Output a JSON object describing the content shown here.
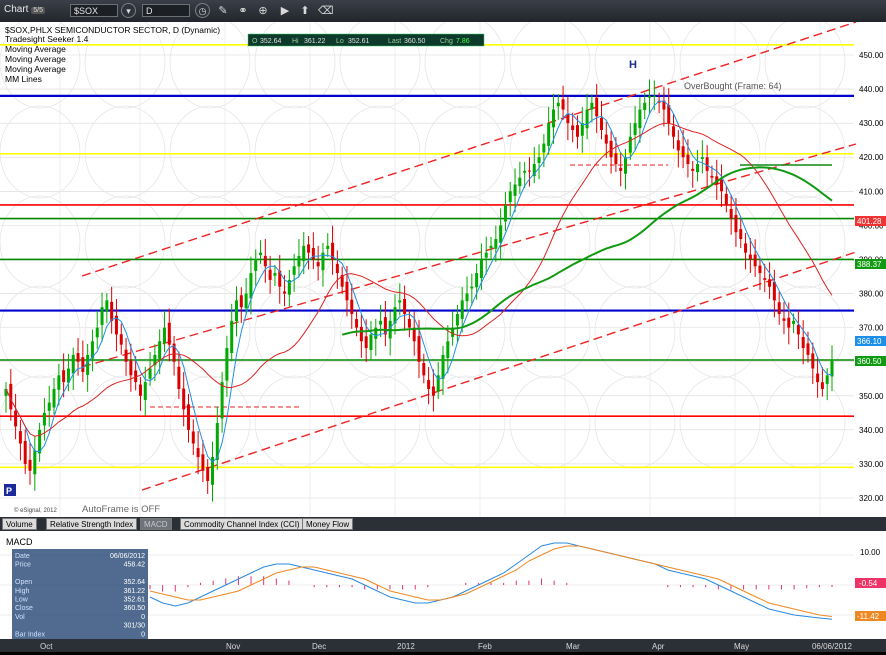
{
  "toolbar": {
    "title": "Chart",
    "badge": "5/5",
    "symbol": "$SOX",
    "interval": "D"
  },
  "header": {
    "line1": "$SOX,PHLX SEMICONDUCTOR SECTOR, D (Dynamic)",
    "line2": "Tradesight Seeker 1.4",
    "line3": "Moving Average",
    "line4": "Moving Average",
    "line5": "Moving Average",
    "line6": "MM Lines"
  },
  "ohlc": {
    "o_label": "O",
    "o_value": "352.64",
    "h_label": "Hi",
    "h_value": "361.22",
    "l_label": "Lo",
    "l_value": "352.61",
    "c_label": "Last",
    "c_value": "360.50",
    "chg_label": "Chg",
    "chg_value": "7.86"
  },
  "annotations": {
    "overbought": "OverBought (Frame: 64)",
    "autoframe": "AutoFrame is OFF",
    "copyright": "© eSignal, 2012",
    "head": "H",
    "p_marker": "P"
  },
  "price_tags": {
    "t1": "401.28",
    "t2": "388.37",
    "t3": "366.10",
    "t4": "360.50"
  },
  "tabs": [
    "Volume",
    "Relative Strength Index",
    "MACD",
    "Commodity Channel Index (CCI)",
    "Money Flow"
  ],
  "macd": {
    "label": "MACD",
    "tag1": "-0.54",
    "tag2": "-11.42"
  },
  "data_window": {
    "rows": [
      {
        "label": "Date",
        "value": "06/06/2012"
      },
      {
        "label": "Price",
        "value": "458.42"
      },
      {
        "label": "",
        "value": ""
      },
      {
        "label": "Open",
        "value": "352.64"
      },
      {
        "label": "High",
        "value": "361.22"
      },
      {
        "label": "Low",
        "value": "352.61"
      },
      {
        "label": "Close",
        "value": "360.50"
      },
      {
        "label": "Vol",
        "value": "0"
      },
      {
        "label": "",
        "value": "301/30"
      },
      {
        "label": "Bar Index",
        "value": "0"
      },
      {
        "label": "Tradesight Seeker 1.4",
        "value": ""
      }
    ]
  },
  "chart_data": {
    "type": "candlestick",
    "y_axis_ticks": [
      320,
      330,
      340,
      350,
      360,
      370,
      380,
      390,
      400,
      410,
      420,
      430,
      440,
      450
    ],
    "x_axis_labels": [
      "Oct",
      "Nov",
      "Dec",
      "2012",
      "Feb",
      "Mar",
      "Apr",
      "May",
      "06/06/2012"
    ],
    "horizontal_levels": [
      {
        "value": 453,
        "color": "#ffff00"
      },
      {
        "value": 438,
        "color": "#0000cc"
      },
      {
        "value": 421,
        "color": "#ffff00"
      },
      {
        "value": 406,
        "color": "#ff0000"
      },
      {
        "value": 402,
        "color": "#008800"
      },
      {
        "value": 390,
        "color": "#008800"
      },
      {
        "value": 375,
        "color": "#0000cc"
      },
      {
        "value": 360.5,
        "color": "#008800"
      },
      {
        "value": 344,
        "color": "#ff0000"
      },
      {
        "value": 329,
        "color": "#ffff00"
      }
    ],
    "closes": [
      352,
      346,
      341,
      336,
      330,
      328,
      334,
      340,
      345,
      348,
      352,
      356,
      354,
      358,
      362,
      360,
      357,
      362,
      366,
      370,
      376,
      378,
      372,
      368,
      365,
      360,
      356,
      354,
      350,
      354,
      358,
      362,
      366,
      370,
      365,
      360,
      352,
      346,
      340,
      336,
      332,
      328,
      325,
      332,
      342,
      354,
      364,
      372,
      378,
      376,
      380,
      386,
      390,
      392,
      388,
      384,
      386,
      382,
      380,
      384,
      388,
      391,
      394,
      392,
      390,
      388,
      392,
      394,
      390,
      386,
      382,
      378,
      374,
      370,
      366,
      364,
      368,
      370,
      372,
      368,
      372,
      376,
      378,
      374,
      370,
      366,
      360,
      356,
      352,
      350,
      356,
      362,
      366,
      370,
      374,
      378,
      380,
      382,
      386,
      390,
      392,
      394,
      396,
      400,
      406,
      410,
      412,
      414,
      416,
      416,
      418,
      420,
      424,
      430,
      434,
      436,
      434,
      430,
      428,
      426,
      430,
      434,
      436,
      432,
      428,
      424,
      420,
      418,
      416,
      420,
      426,
      430,
      434,
      436,
      438,
      438,
      436,
      434,
      430,
      426,
      422,
      420,
      418,
      416,
      418,
      420,
      416,
      414,
      412,
      410,
      406,
      402,
      398,
      396,
      392,
      390,
      388,
      386,
      384,
      382,
      378,
      374,
      372,
      370,
      372,
      368,
      364,
      362,
      358,
      354,
      352,
      356,
      360.5
    ]
  },
  "macd_data": {
    "macd": [
      -4,
      -6,
      -7,
      -6,
      -4,
      -2,
      0,
      2,
      4,
      6,
      7,
      7,
      6,
      5,
      4,
      3,
      2,
      0,
      -2,
      -4,
      -5,
      -6,
      -6,
      -5,
      -4,
      -2,
      0,
      2,
      4,
      7,
      10,
      13,
      14,
      14,
      13,
      12,
      11,
      10,
      9,
      8,
      7,
      5,
      4,
      3,
      2,
      0,
      -2,
      -4,
      -6,
      -8,
      -9,
      -10,
      -10.5,
      -11,
      -11.42
    ],
    "signal": [
      -2,
      -3,
      -4,
      -5,
      -5,
      -4,
      -3,
      -2,
      0,
      2,
      4,
      5,
      6,
      6,
      5,
      4,
      3,
      2,
      0,
      -2,
      -3,
      -4,
      -5,
      -5,
      -4,
      -3,
      -1,
      1,
      3,
      5,
      8,
      10,
      12,
      13,
      13,
      12,
      11,
      10,
      9,
      8,
      7,
      6,
      5,
      4,
      3,
      2,
      0,
      -2,
      -4,
      -6,
      -7,
      -8,
      -9,
      -10,
      -10.5
    ],
    "hist_end": -0.54
  }
}
